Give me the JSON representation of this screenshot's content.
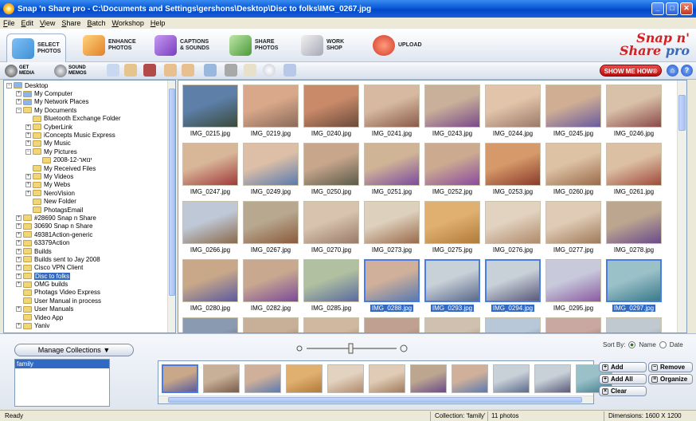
{
  "window": {
    "title": "Snap 'n Share pro - C:\\Documents and Settings\\gershons\\Desktop\\Disc to folks\\IMG_0267.jpg",
    "controls": [
      "_",
      "□",
      "✕"
    ]
  },
  "menu": [
    "File",
    "Edit",
    "View",
    "Share",
    "Batch",
    "Workshop",
    "Help"
  ],
  "main_toolbar": [
    {
      "l1": "SELECT",
      "l2": "PHOTOS",
      "icon": "select-photos-icon",
      "color": "#3f8fd6"
    },
    {
      "l1": "ENHANCE",
      "l2": "PHOTOS",
      "icon": "enhance-photos-icon",
      "color": "#e0822a"
    },
    {
      "l1": "CAPTIONS",
      "l2": "& SOUNDS",
      "icon": "captions-sounds-icon",
      "color": "#7b3cc0"
    },
    {
      "l1": "SHARE",
      "l2": "PHOTOS",
      "icon": "share-photos-icon",
      "color": "#4a9a3a"
    },
    {
      "l1": "WORK",
      "l2": "SHOP",
      "icon": "workshop-icon",
      "color": "#b8b8b8"
    },
    {
      "l1": "UPLOAD",
      "l2": "",
      "icon": "upload-icon",
      "color": "#d23a2a"
    }
  ],
  "logo": {
    "line1": "Snap n'",
    "line2": "Share",
    "line3": "pro"
  },
  "sub_toolbar": {
    "get_media": {
      "l1": "GET",
      "l2": "MEDIA"
    },
    "sound_memos": {
      "l1": "SOUND",
      "l2": "MEMOS"
    },
    "icons": [
      "info-icon",
      "checklist-icon",
      "delete-icon",
      "rotate-left-icon",
      "rotate-right-icon",
      "slideshow-icon",
      "print-icon",
      "email-icon",
      "cd-icon",
      "crop-icon"
    ],
    "show_me_how": "SHOW ME HOW®",
    "home": "⌂",
    "help": "?"
  },
  "tree": [
    {
      "label": "Desktop",
      "depth": 0,
      "pm": "−",
      "icon": "desktop-icon"
    },
    {
      "label": "My Computer",
      "depth": 1,
      "pm": "+",
      "icon": "computer-icon"
    },
    {
      "label": "My Network Places",
      "depth": 1,
      "pm": "+",
      "icon": "network-icon"
    },
    {
      "label": "My Documents",
      "depth": 1,
      "pm": "−",
      "icon": "folder-icon"
    },
    {
      "label": "Bluetooth Exchange Folder",
      "depth": 2,
      "pm": "",
      "icon": "folder-icon"
    },
    {
      "label": "CyberLink",
      "depth": 2,
      "pm": "+",
      "icon": "folder-icon"
    },
    {
      "label": "iConcepts Music Express",
      "depth": 2,
      "pm": "+",
      "icon": "folder-icon"
    },
    {
      "label": "My Music",
      "depth": 2,
      "pm": "+",
      "icon": "music-folder-icon"
    },
    {
      "label": "My Pictures",
      "depth": 2,
      "pm": "−",
      "icon": "pictures-folder-icon"
    },
    {
      "label": "2008-12-ינואר",
      "depth": 3,
      "pm": "",
      "icon": "folder-icon"
    },
    {
      "label": "My Received Files",
      "depth": 2,
      "pm": "",
      "icon": "folder-icon"
    },
    {
      "label": "My Videos",
      "depth": 2,
      "pm": "+",
      "icon": "videos-folder-icon"
    },
    {
      "label": "My Webs",
      "depth": 2,
      "pm": "+",
      "icon": "webs-folder-icon"
    },
    {
      "label": "NeroVision",
      "depth": 2,
      "pm": "+",
      "icon": "folder-icon"
    },
    {
      "label": "New Folder",
      "depth": 2,
      "pm": "",
      "icon": "folder-icon"
    },
    {
      "label": "PhotagsEmail",
      "depth": 2,
      "pm": "",
      "icon": "folder-icon"
    },
    {
      "label": "#28690 Snap n Share",
      "depth": 1,
      "pm": "+",
      "icon": "folder-icon"
    },
    {
      "label": "30690 Snap n Share",
      "depth": 1,
      "pm": "+",
      "icon": "folder-icon"
    },
    {
      "label": "49381Action-generic",
      "depth": 1,
      "pm": "+",
      "icon": "folder-icon"
    },
    {
      "label": "63379Action",
      "depth": 1,
      "pm": "+",
      "icon": "folder-icon"
    },
    {
      "label": "Builds",
      "depth": 1,
      "pm": "+",
      "icon": "folder-icon"
    },
    {
      "label": "Builds sent to Jay 2008",
      "depth": 1,
      "pm": "+",
      "icon": "folder-icon"
    },
    {
      "label": "Cisco VPN Client",
      "depth": 1,
      "pm": "+",
      "icon": "folder-icon"
    },
    {
      "label": "Disc to folks",
      "depth": 1,
      "pm": "+",
      "icon": "folder-icon",
      "selected": true
    },
    {
      "label": "OMG builds",
      "depth": 1,
      "pm": "+",
      "icon": "folder-icon"
    },
    {
      "label": "Photags Video Express",
      "depth": 1,
      "pm": "",
      "icon": "folder-icon"
    },
    {
      "label": "User Manual in process",
      "depth": 1,
      "pm": "",
      "icon": "folder-icon"
    },
    {
      "label": "User Manuals",
      "depth": 1,
      "pm": "+",
      "icon": "folder-icon"
    },
    {
      "label": "Video App",
      "depth": 1,
      "pm": "",
      "icon": "folder-icon"
    },
    {
      "label": "Yaniv",
      "depth": 1,
      "pm": "+",
      "icon": "folder-icon"
    }
  ],
  "photos": [
    {
      "name": "IMG_0215.jpg",
      "c1": "#5d7fa8",
      "c2": "#3a4a3a"
    },
    {
      "name": "IMG_0219.jpg",
      "c1": "#d9a88a",
      "c2": "#8a6a5a"
    },
    {
      "name": "IMG_0240.jpg",
      "c1": "#c98a6a",
      "c2": "#6a4a3a"
    },
    {
      "name": "IMG_0241.jpg",
      "c1": "#d6b9a0",
      "c2": "#8a5a4a"
    },
    {
      "name": "IMG_0243.jpg",
      "c1": "#c9b09a",
      "c2": "#7a4a8a"
    },
    {
      "name": "IMG_0244.jpg",
      "c1": "#e2c4aa",
      "c2": "#9a7a6a"
    },
    {
      "name": "IMG_0245.jpg",
      "c1": "#cfae94",
      "c2": "#6a5aa0"
    },
    {
      "name": "IMG_0246.jpg",
      "c1": "#d9c0a8",
      "c2": "#8a4a4a"
    },
    {
      "name": "IMG_0247.jpg",
      "c1": "#d8b698",
      "c2": "#a03a3a"
    },
    {
      "name": "IMG_0249.jpg",
      "c1": "#dcbfa6",
      "c2": "#5a7ab0"
    },
    {
      "name": "IMG_0250.jpg",
      "c1": "#c8a68c",
      "c2": "#5a5a4a"
    },
    {
      "name": "IMG_0251.jpg",
      "c1": "#d0b496",
      "c2": "#7a4aa0"
    },
    {
      "name": "IMG_0252.jpg",
      "c1": "#cbaa90",
      "c2": "#8a4aa0"
    },
    {
      "name": "IMG_0253.jpg",
      "c1": "#d69a6a",
      "c2": "#8a3a2a"
    },
    {
      "name": "IMG_0260.jpg",
      "c1": "#ddc2a4",
      "c2": "#9a6a4a"
    },
    {
      "name": "IMG_0261.jpg",
      "c1": "#dcc0a4",
      "c2": "#a04a3a"
    },
    {
      "name": "IMG_0266.jpg",
      "c1": "#bfc8d6",
      "c2": "#8a6a4a"
    },
    {
      "name": "IMG_0267.jpg",
      "c1": "#b8a890",
      "c2": "#8a5a3a"
    },
    {
      "name": "IMG_0270.jpg",
      "c1": "#d8c4ae",
      "c2": "#9a7a6a"
    },
    {
      "name": "IMG_0273.jpg",
      "c1": "#ddd0bc",
      "c2": "#9a6a4a"
    },
    {
      "name": "IMG_0275.jpg",
      "c1": "#e0b070",
      "c2": "#b07a3a"
    },
    {
      "name": "IMG_0276.jpg",
      "c1": "#e2d2c0",
      "c2": "#b08a6a"
    },
    {
      "name": "IMG_0277.jpg",
      "c1": "#e0ccb6",
      "c2": "#a07a5a"
    },
    {
      "name": "IMG_0278.jpg",
      "c1": "#bca690",
      "c2": "#6a4a8a"
    },
    {
      "name": "IMG_0280.jpg",
      "c1": "#c8a888",
      "c2": "#5a5aa0"
    },
    {
      "name": "IMG_0282.jpg",
      "c1": "#c9a890",
      "c2": "#7a4a9a"
    },
    {
      "name": "IMG_0285.jpg",
      "c1": "#b0c0a0",
      "c2": "#5a6aa0"
    },
    {
      "name": "IMG_0288.jpg",
      "c1": "#d0b09a",
      "c2": "#5a7ab0",
      "selected": true
    },
    {
      "name": "IMG_0293.jpg",
      "c1": "#c8d0d8",
      "c2": "#5a6a8a",
      "selected": true
    },
    {
      "name": "IMG_0294.jpg",
      "c1": "#c8d0d8",
      "c2": "#5a5a7a",
      "selected": true
    },
    {
      "name": "IMG_0295.jpg",
      "c1": "#c8cadc",
      "c2": "#8a5aa0"
    },
    {
      "name": "IMG_0297.jpg",
      "c1": "#9ac0c8",
      "c2": "#3a7a8a",
      "selected": true
    },
    {
      "name": "",
      "c1": "#8a9ab0",
      "c2": "#6a4a3a"
    },
    {
      "name": "",
      "c1": "#c8b098",
      "c2": "#7a5a4a"
    },
    {
      "name": "",
      "c1": "#d0b8a0",
      "c2": "#8a5a3a"
    },
    {
      "name": "",
      "c1": "#c0a090",
      "c2": "#8a6a5a"
    },
    {
      "name": "",
      "c1": "#d0c0b0",
      "c2": "#9a6a4a"
    },
    {
      "name": "",
      "c1": "#b8c8d8",
      "c2": "#5a6a9a"
    },
    {
      "name": "",
      "c1": "#c8a8a0",
      "c2": "#8a4a4a"
    },
    {
      "name": "",
      "c1": "#c0c8d0",
      "c2": "#7a7a8a"
    }
  ],
  "collections": {
    "manage_label": "Manage Collections",
    "items": [
      "family"
    ]
  },
  "sort": {
    "label": "Sort By:",
    "name": "Name",
    "date": "Date",
    "selected": "Name"
  },
  "strip": [
    {
      "c1": "#c8a888",
      "c2": "#5a5aa0"
    },
    {
      "c1": "#c8b098",
      "c2": "#7a5a4a"
    },
    {
      "c1": "#d0b09a",
      "c2": "#5a7ab0"
    },
    {
      "c1": "#e0b070",
      "c2": "#b07a3a"
    },
    {
      "c1": "#e2d2c0",
      "c2": "#b08a6a"
    },
    {
      "c1": "#e0ccb6",
      "c2": "#a07a5a"
    },
    {
      "c1": "#bca690",
      "c2": "#6a4a8a"
    },
    {
      "c1": "#d0b09a",
      "c2": "#5a7ab0"
    },
    {
      "c1": "#c8d0d8",
      "c2": "#5a6a8a"
    },
    {
      "c1": "#c8d0d8",
      "c2": "#5a5a7a"
    },
    {
      "c1": "#9ac0c8",
      "c2": "#3a7a8a"
    }
  ],
  "collection_buttons": {
    "add": "Add",
    "add_all": "Add All",
    "clear": "Clear",
    "remove": "Remove",
    "organize": "Organize"
  },
  "status": {
    "left": "Ready",
    "collection": "Collection: 'family'",
    "count": "11 photos",
    "dimensions": "Dimensions: 1600 X 1200"
  }
}
